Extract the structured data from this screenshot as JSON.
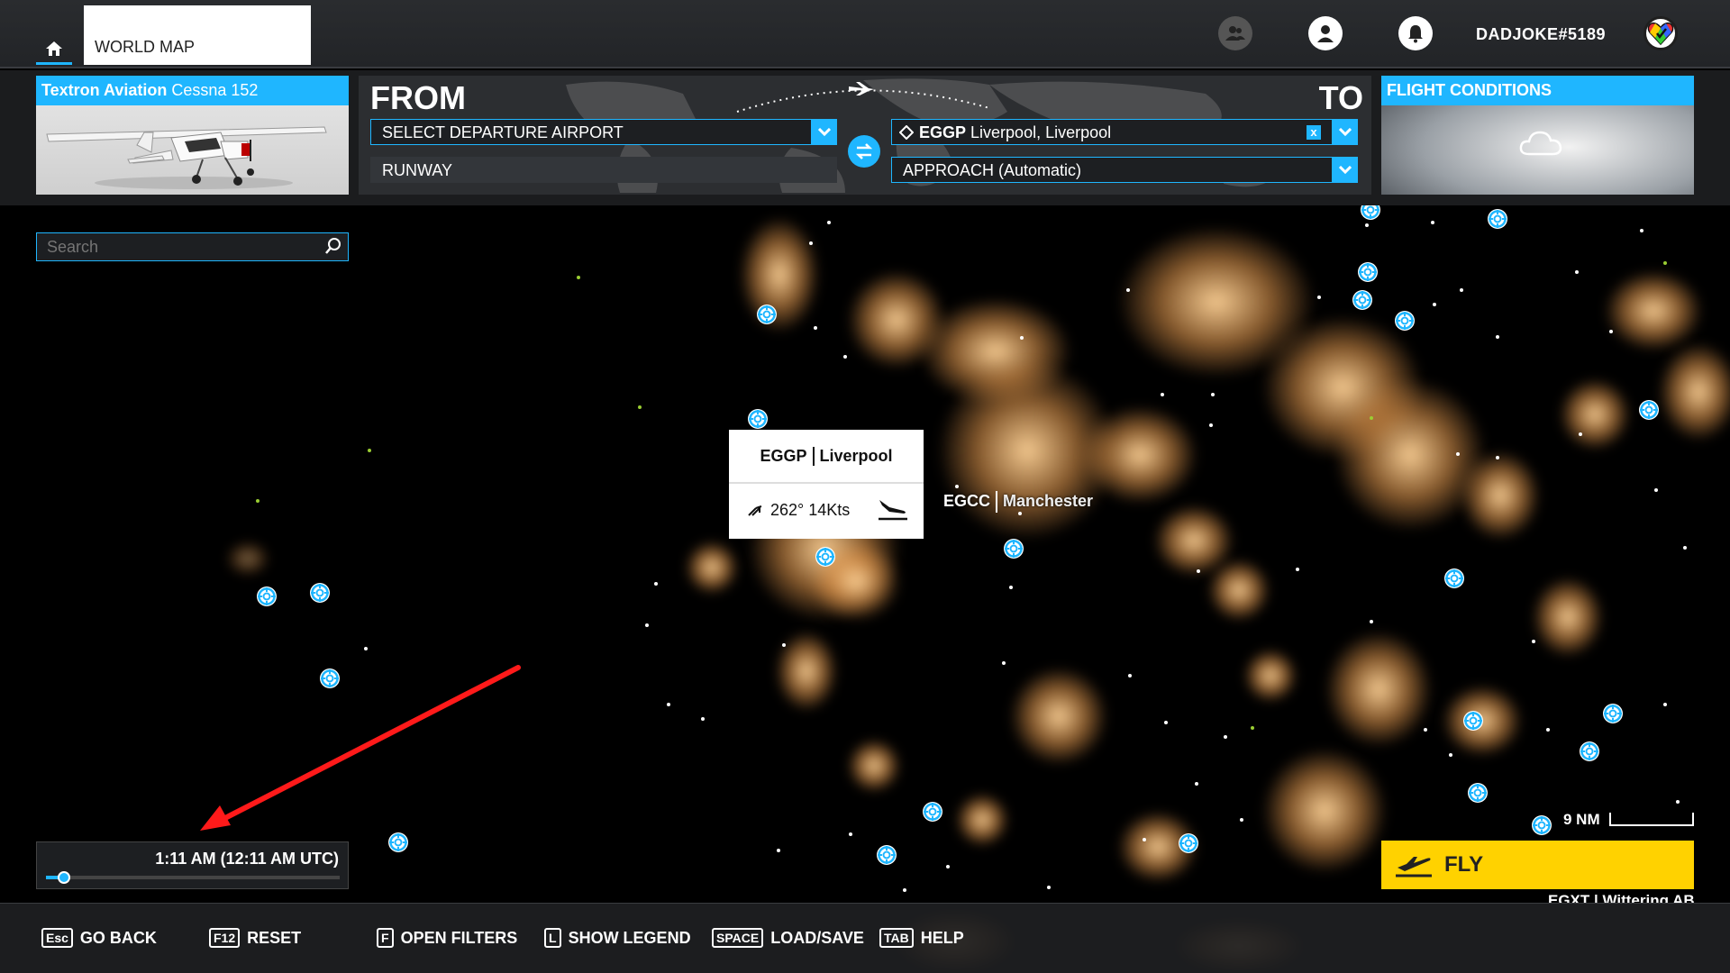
{
  "topbar": {
    "home_icon": "home-icon",
    "tab_label": "WORLD MAP",
    "username": "DADJOKE#5189",
    "icons": [
      "friends-icon",
      "profile-icon",
      "notification-icon",
      "badge-icon"
    ]
  },
  "aircraft": {
    "maker": "Textron Aviation",
    "model": "Cessna 152"
  },
  "route": {
    "from_label": "FROM",
    "to_label": "TO",
    "departure_placeholder": "SELECT DEPARTURE AIRPORT",
    "runway_label": "RUNWAY",
    "arrival_icao": "EGGP",
    "arrival_name": "Liverpool, Liverpool",
    "clear_label": "x",
    "approach_label": "APPROACH (Automatic)"
  },
  "conditions": {
    "title": "FLIGHT CONDITIONS"
  },
  "search": {
    "placeholder": "Search"
  },
  "popup": {
    "icao": "EGGP",
    "city": "Liverpool",
    "wind": "262° 14Kts"
  },
  "map_labels": {
    "manchester_icao": "EGCC",
    "manchester_city": "Manchester"
  },
  "time": {
    "label": "1:11 AM (12:11 AM UTC)",
    "progress": 0.06
  },
  "scale": {
    "label": "9 NM"
  },
  "fly": {
    "label": "FLY",
    "under_text": "EGXT | Wittering AB"
  },
  "bottom_hints": [
    {
      "key": "Esc",
      "label": "GO BACK"
    },
    {
      "key": "F12",
      "label": "RESET"
    },
    {
      "key": "F",
      "label": "OPEN FILTERS"
    },
    {
      "key": "L",
      "label": "SHOW LEGEND"
    },
    {
      "key": "SPACE",
      "label": "LOAD/SAVE"
    },
    {
      "key": "TAB",
      "label": "HELP"
    }
  ],
  "colors": {
    "accent": "#1fb6ff",
    "fly": "#ffd200",
    "annotation_arrow": "#ff1a1a"
  }
}
